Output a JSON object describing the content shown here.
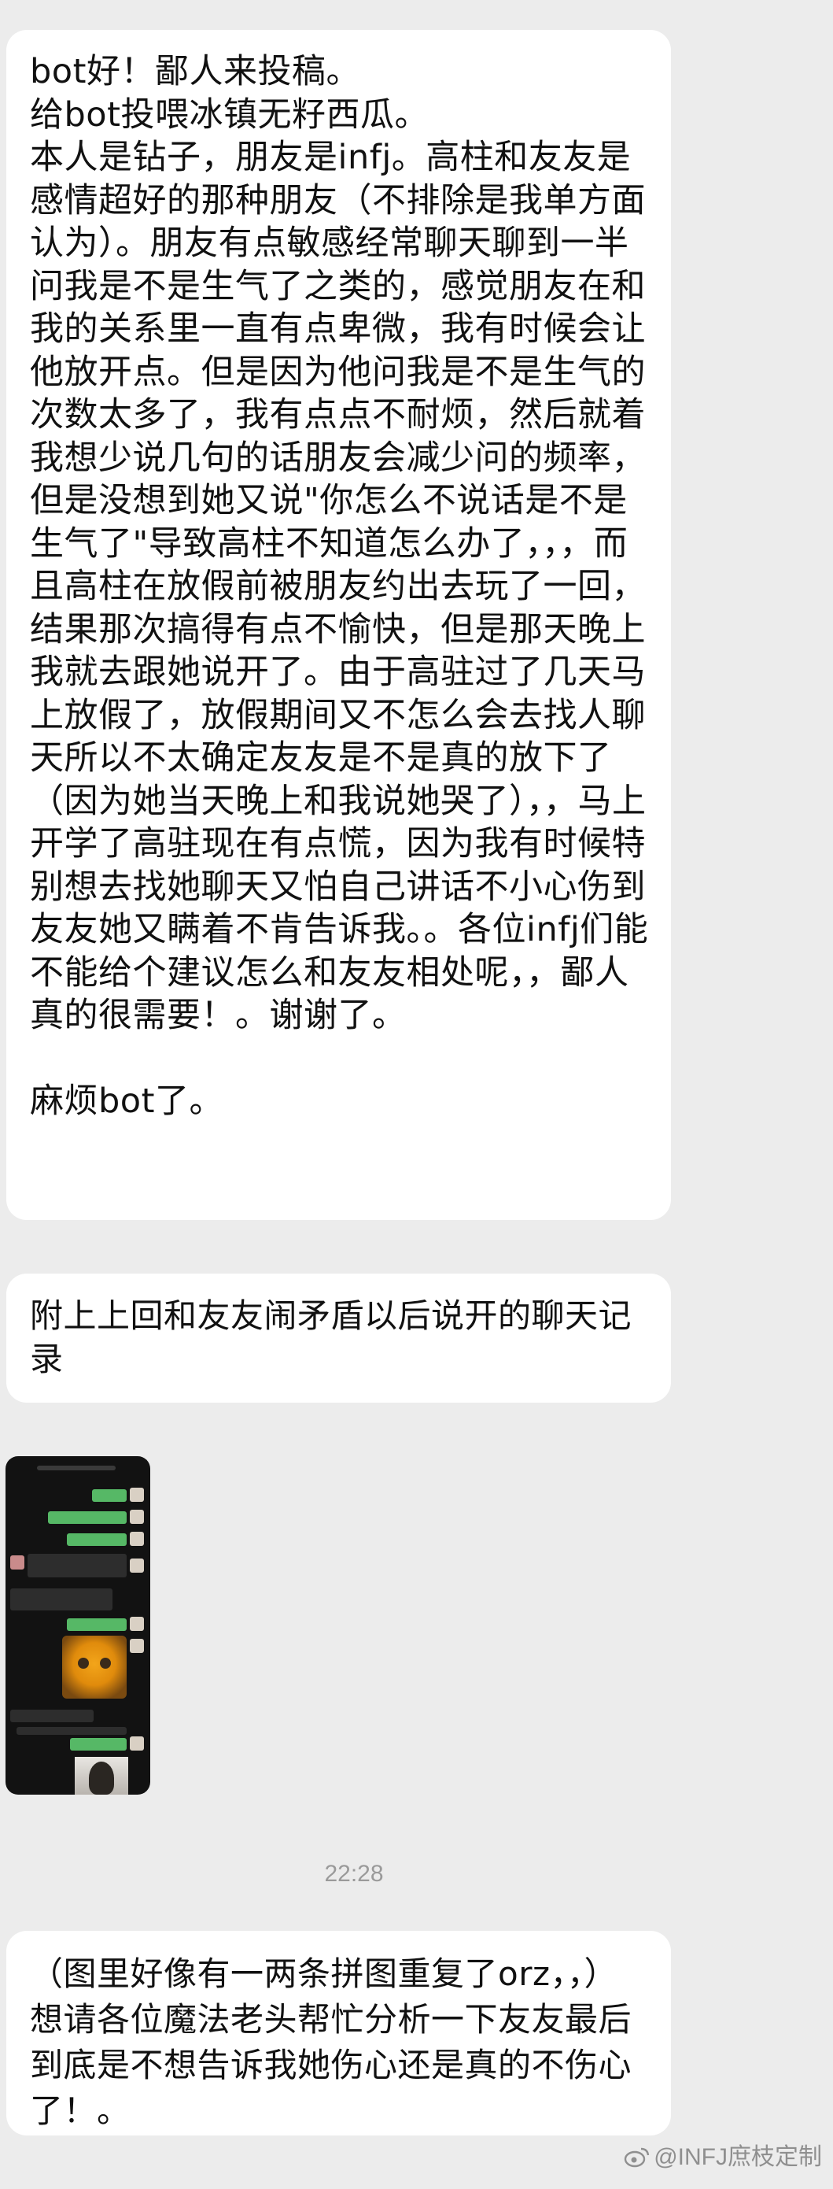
{
  "messages": [
    {
      "text": "bot好！鄙人来投稿。\n给bot投喂冰镇无籽西瓜。\n 本人是钻子，朋友是infj。高柱和友友是感情超好的那种朋友（不排除是我单方面认为）。朋友有点敏感经常聊天聊到一半问我是不是生气了之类的，感觉朋友在和我的关系里一直有点卑微，我有时候会让他放开点。但是因为他问我是不是生气的次数太多了，我有点点不耐烦，然后就着我想少说几句的话朋友会减少问的频率，但是没想到她又说\"你怎么不说话是不是生气了\"导致高柱不知道怎么办了，，，而且高柱在放假前被朋友约出去玩了一回，结果那次搞得有点不愉快，但是那天晚上我就去跟她说开了。由于高驻过了几天马上放假了，放假期间又不怎么会去找人聊天所以不太确定友友是不是真的放下了（因为她当天晚上和我说她哭了），，马上开学了高驻现在有点慌，因为我有时候特别想去找她聊天又怕自己讲话不小心伤到友友她又瞒着不肯告诉我。。各位infj们能不能给个建议怎么和友友相处呢，，鄙人真的很需要！。谢谢了。\n\n麻烦bot了。"
    },
    {
      "text": "附上上回和友友闹矛盾以后说开的聊天记录"
    },
    {
      "text": "（图里好像有一两条拼图重复了orz，，）想请各位魔法老头帮忙分析一下友友最后到底是不想告诉我她伤心还是真的不伤心了！。"
    }
  ],
  "timestamp": "22:28",
  "watermark": "@INFJ庶枝定制",
  "colors": {
    "background": "#ececec",
    "bubble": "#ffffff",
    "thumb_bg": "#121212",
    "thumb_green": "#56b866"
  }
}
